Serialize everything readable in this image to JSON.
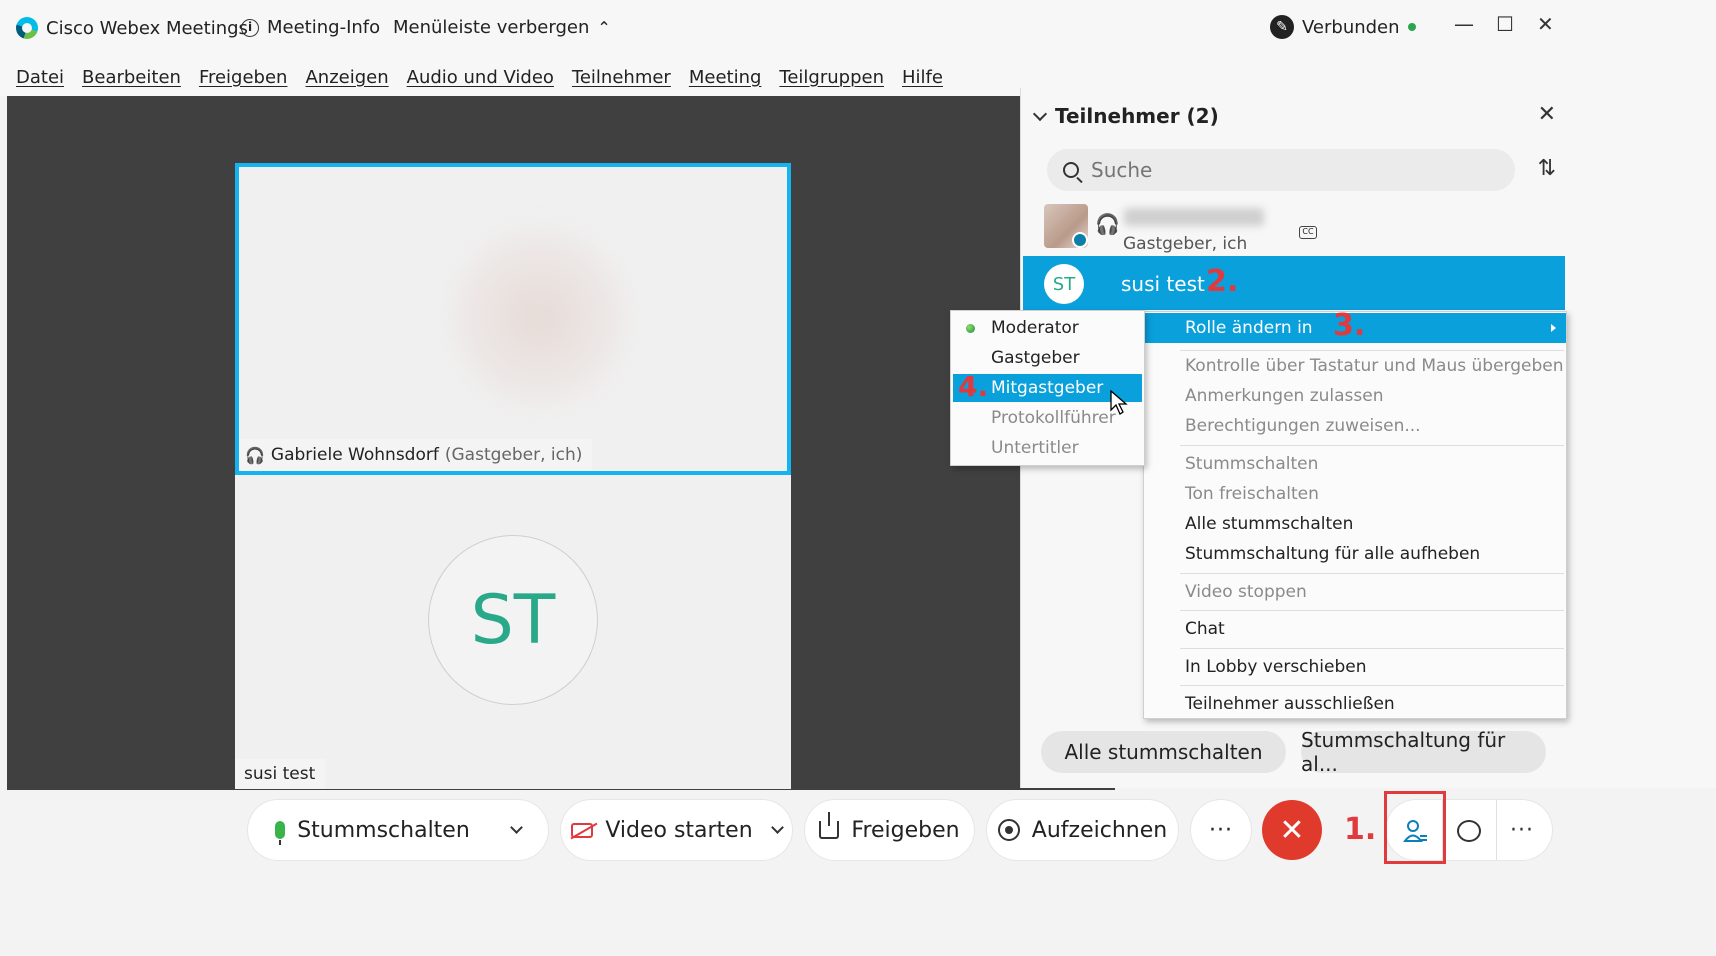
{
  "titlebar": {
    "app_name": "Cisco Webex Meetings",
    "meeting_info": "Meeting-Info",
    "hide_menubar": "Menüleiste verbergen",
    "connection_status": "Verbunden"
  },
  "menu": [
    "Datei",
    "Bearbeiten",
    "Freigeben",
    "Anzeigen",
    "Audio und Video",
    "Teilnehmer",
    "Meeting",
    "Teilgruppen",
    "Hilfe"
  ],
  "video": {
    "tile1_name": "Gabriele Wohnsdorf",
    "tile1_role": "(Gastgeber, ich)",
    "tile2_initials": "ST",
    "tile2_name": "susi test"
  },
  "panel": {
    "title": "Teilnehmer (2)",
    "search_placeholder": "Suche",
    "participant1_role": "Gastgeber, ich",
    "participant2_initials": "ST",
    "participant2_name": "susi test",
    "mute_all_button": "Alle stummschalten",
    "unmute_all_button": "Stummschaltung für al..."
  },
  "steps": {
    "s1": "1.",
    "s2": "2.",
    "s3": "3.",
    "s4": "4."
  },
  "context_menu": {
    "change_role": "Rolle ändern in",
    "pass_control": "Kontrolle über Tastatur und Maus übergeben",
    "allow_annotation": "Anmerkungen zulassen",
    "assign_privileges": "Berechtigungen zuweisen...",
    "mute": "Stummschalten",
    "unmute": "Ton freischalten",
    "mute_all": "Alle stummschalten",
    "unmute_all": "Stummschaltung für alle aufheben",
    "stop_video": "Video stoppen",
    "chat": "Chat",
    "move_to_lobby": "In Lobby verschieben",
    "expel": "Teilnehmer ausschließen"
  },
  "role_submenu": {
    "moderator": "Moderator",
    "host": "Gastgeber",
    "cohost": "Mitgastgeber",
    "note_taker": "Protokollführer",
    "cc_provider": "Untertitler",
    "selected": "Moderator",
    "highlighted": "Mitgastgeber"
  },
  "toolbar": {
    "mute": "Stummschalten",
    "start_video": "Video starten",
    "share": "Freigeben",
    "record": "Aufzeichnen"
  },
  "colors": {
    "accent": "#0aa0dc",
    "active_border": "#14b4f0",
    "end_call": "#e03a2c",
    "annotation_red": "#e03a3e",
    "initials": "#2aa88a"
  }
}
